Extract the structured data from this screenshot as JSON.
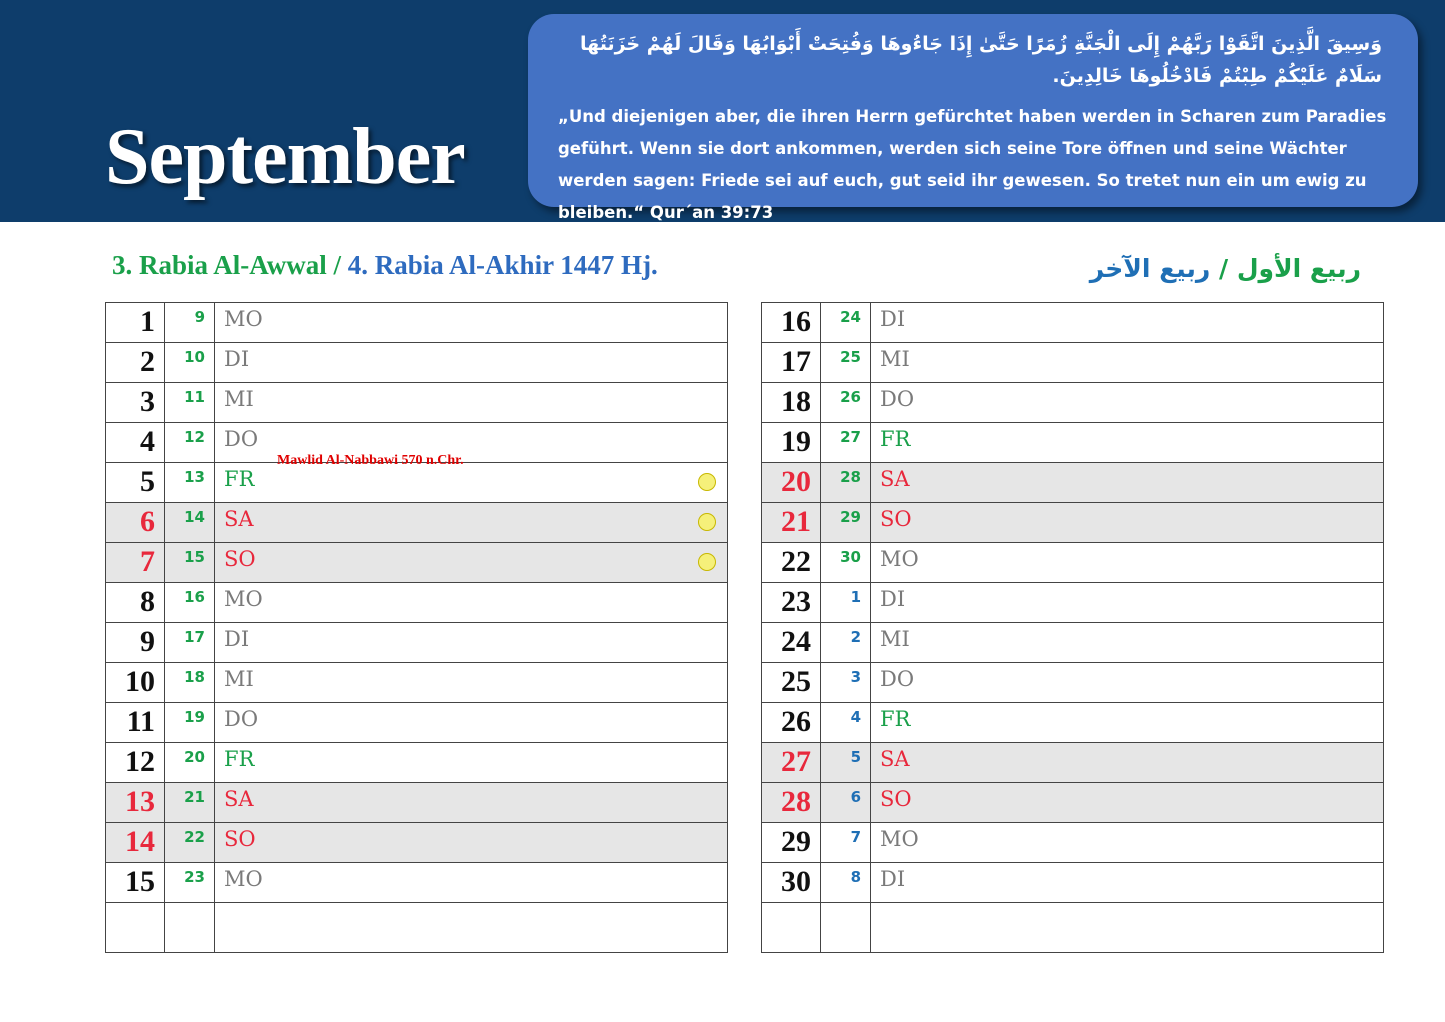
{
  "header": {
    "month": "September",
    "verse_arabic": "وَسِيقَ الَّذِينَ اتَّقَوْا رَبَّهُمْ إِلَى الْجَنَّةِ زُمَرًا حَتَّىٰ إِذَا جَاءُوهَا وَفُتِحَتْ أَبْوَابُهَا وَقَالَ لَهُمْ خَزَنَتُهَا سَلَامٌ عَلَيْكُمْ طِبْتُمْ فَادْخُلُوهَا خَالِدِينَ.",
    "verse_german": "„Und diejenigen aber, die ihren Herrn gefürchtet haben werden in Scharen zum Paradies geführt. Wenn sie dort ankommen, werden sich seine Tore öffnen und seine Wächter werden sagen: Friede sei auf euch, gut seid ihr gewesen. So tretet nun ein um ewig zu bleiben.“ Qur´an 39:73"
  },
  "hijri_title": {
    "part1": "3. Rabia Al-Awwal / ",
    "part2": "4. Rabia Al-Akhir 1447 Hj."
  },
  "arabic_months": {
    "part1": "ربيع الأول",
    "sep": " / ",
    "part2": "ربيع الآخر"
  },
  "colors": {
    "header_bg": "#0e3d6b",
    "verse_box": "#4472c4",
    "green": "#1aa04a",
    "blue": "#1f6fb5",
    "red": "#e8283c",
    "weekend_bg": "#e6e6e6",
    "moon": "#f5f07a"
  },
  "days": [
    {
      "d": "1",
      "h": "9",
      "wd": "MO",
      "month": "awwal"
    },
    {
      "d": "2",
      "h": "10",
      "wd": "DI",
      "month": "awwal"
    },
    {
      "d": "3",
      "h": "11",
      "wd": "MI",
      "month": "awwal"
    },
    {
      "d": "4",
      "h": "12",
      "wd": "DO",
      "month": "awwal",
      "event": "Mawlid Al-Nabbawi  570 n.Chr."
    },
    {
      "d": "5",
      "h": "13",
      "wd": "FR",
      "month": "awwal",
      "moon": true
    },
    {
      "d": "6",
      "h": "14",
      "wd": "SA",
      "month": "awwal",
      "weekend": true,
      "moon": true
    },
    {
      "d": "7",
      "h": "15",
      "wd": "SO",
      "month": "awwal",
      "weekend": true,
      "moon": true
    },
    {
      "d": "8",
      "h": "16",
      "wd": "MO",
      "month": "awwal"
    },
    {
      "d": "9",
      "h": "17",
      "wd": "DI",
      "month": "awwal"
    },
    {
      "d": "10",
      "h": "18",
      "wd": "MI",
      "month": "awwal"
    },
    {
      "d": "11",
      "h": "19",
      "wd": "DO",
      "month": "awwal"
    },
    {
      "d": "12",
      "h": "20",
      "wd": "FR",
      "month": "awwal"
    },
    {
      "d": "13",
      "h": "21",
      "wd": "SA",
      "month": "awwal",
      "weekend": true
    },
    {
      "d": "14",
      "h": "22",
      "wd": "SO",
      "month": "awwal",
      "weekend": true
    },
    {
      "d": "15",
      "h": "23",
      "wd": "MO",
      "month": "awwal"
    },
    {
      "d": "16",
      "h": "24",
      "wd": "DI",
      "month": "awwal"
    },
    {
      "d": "17",
      "h": "25",
      "wd": "MI",
      "month": "awwal"
    },
    {
      "d": "18",
      "h": "26",
      "wd": "DO",
      "month": "awwal"
    },
    {
      "d": "19",
      "h": "27",
      "wd": "FR",
      "month": "awwal"
    },
    {
      "d": "20",
      "h": "28",
      "wd": "SA",
      "month": "awwal",
      "weekend": true
    },
    {
      "d": "21",
      "h": "29",
      "wd": "SO",
      "month": "awwal",
      "weekend": true
    },
    {
      "d": "22",
      "h": "30",
      "wd": "MO",
      "month": "awwal"
    },
    {
      "d": "23",
      "h": "1",
      "wd": "DI",
      "month": "akhir"
    },
    {
      "d": "24",
      "h": "2",
      "wd": "MI",
      "month": "akhir"
    },
    {
      "d": "25",
      "h": "3",
      "wd": "DO",
      "month": "akhir"
    },
    {
      "d": "26",
      "h": "4",
      "wd": "FR",
      "month": "akhir"
    },
    {
      "d": "27",
      "h": "5",
      "wd": "SA",
      "month": "akhir",
      "weekend": true
    },
    {
      "d": "28",
      "h": "6",
      "wd": "SO",
      "month": "akhir",
      "weekend": true
    },
    {
      "d": "29",
      "h": "7",
      "wd": "MO",
      "month": "akhir"
    },
    {
      "d": "30",
      "h": "8",
      "wd": "DI",
      "month": "akhir"
    }
  ]
}
